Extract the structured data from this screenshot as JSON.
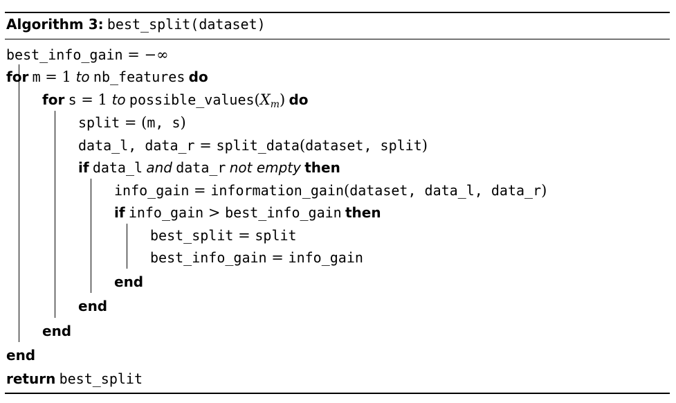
{
  "caption": {
    "label": "Algorithm 3:",
    "name": "best_split",
    "arg": "(dataset)"
  },
  "lines": {
    "l1": {
      "var": "best_info_gain",
      "op": " = −∞"
    },
    "l2": {
      "kw": "for",
      "var": "m",
      "op": " = 1 ",
      "to": "to",
      "bound": "nb_features",
      "do": "do"
    },
    "l3": {
      "kw": "for",
      "var": "s",
      "op": " = 1 ",
      "to": "to",
      "fn": "possible_values",
      "open": "(",
      "math": "X",
      "sub": "m",
      "close": ")",
      "do": "do"
    },
    "l4": {
      "var": "split",
      "op": " = (",
      "args": "m, s",
      "close": ")"
    },
    "l5": {
      "lhs": "data_l, data_r",
      "op": " = ",
      "fn": "split_data",
      "open": "(",
      "args": "dataset, split",
      "close": ")"
    },
    "l6": {
      "kw": "if",
      "a": "data_l",
      "and": "and",
      "b": "data_r",
      "cond": "not empty",
      "then": "then"
    },
    "l7": {
      "var": "info_gain",
      "op": " = ",
      "fn": "information_gain",
      "open": "(",
      "args": "dataset, data_l, data_r",
      "close": ")"
    },
    "l8": {
      "kw": "if",
      "a": "info_gain",
      "op": " > ",
      "b": "best_info_gain",
      "then": "then"
    },
    "l9": {
      "var": "best_split",
      "op": " = ",
      "val": "split"
    },
    "l10": {
      "var": "best_info_gain",
      "op": " = ",
      "val": "info_gain"
    },
    "l11": {
      "kw": "end"
    },
    "l12": {
      "kw": "end"
    },
    "l13": {
      "kw": "end"
    },
    "l14": {
      "kw": "end"
    },
    "l15": {
      "kw": "return",
      "val": "best_split"
    }
  }
}
